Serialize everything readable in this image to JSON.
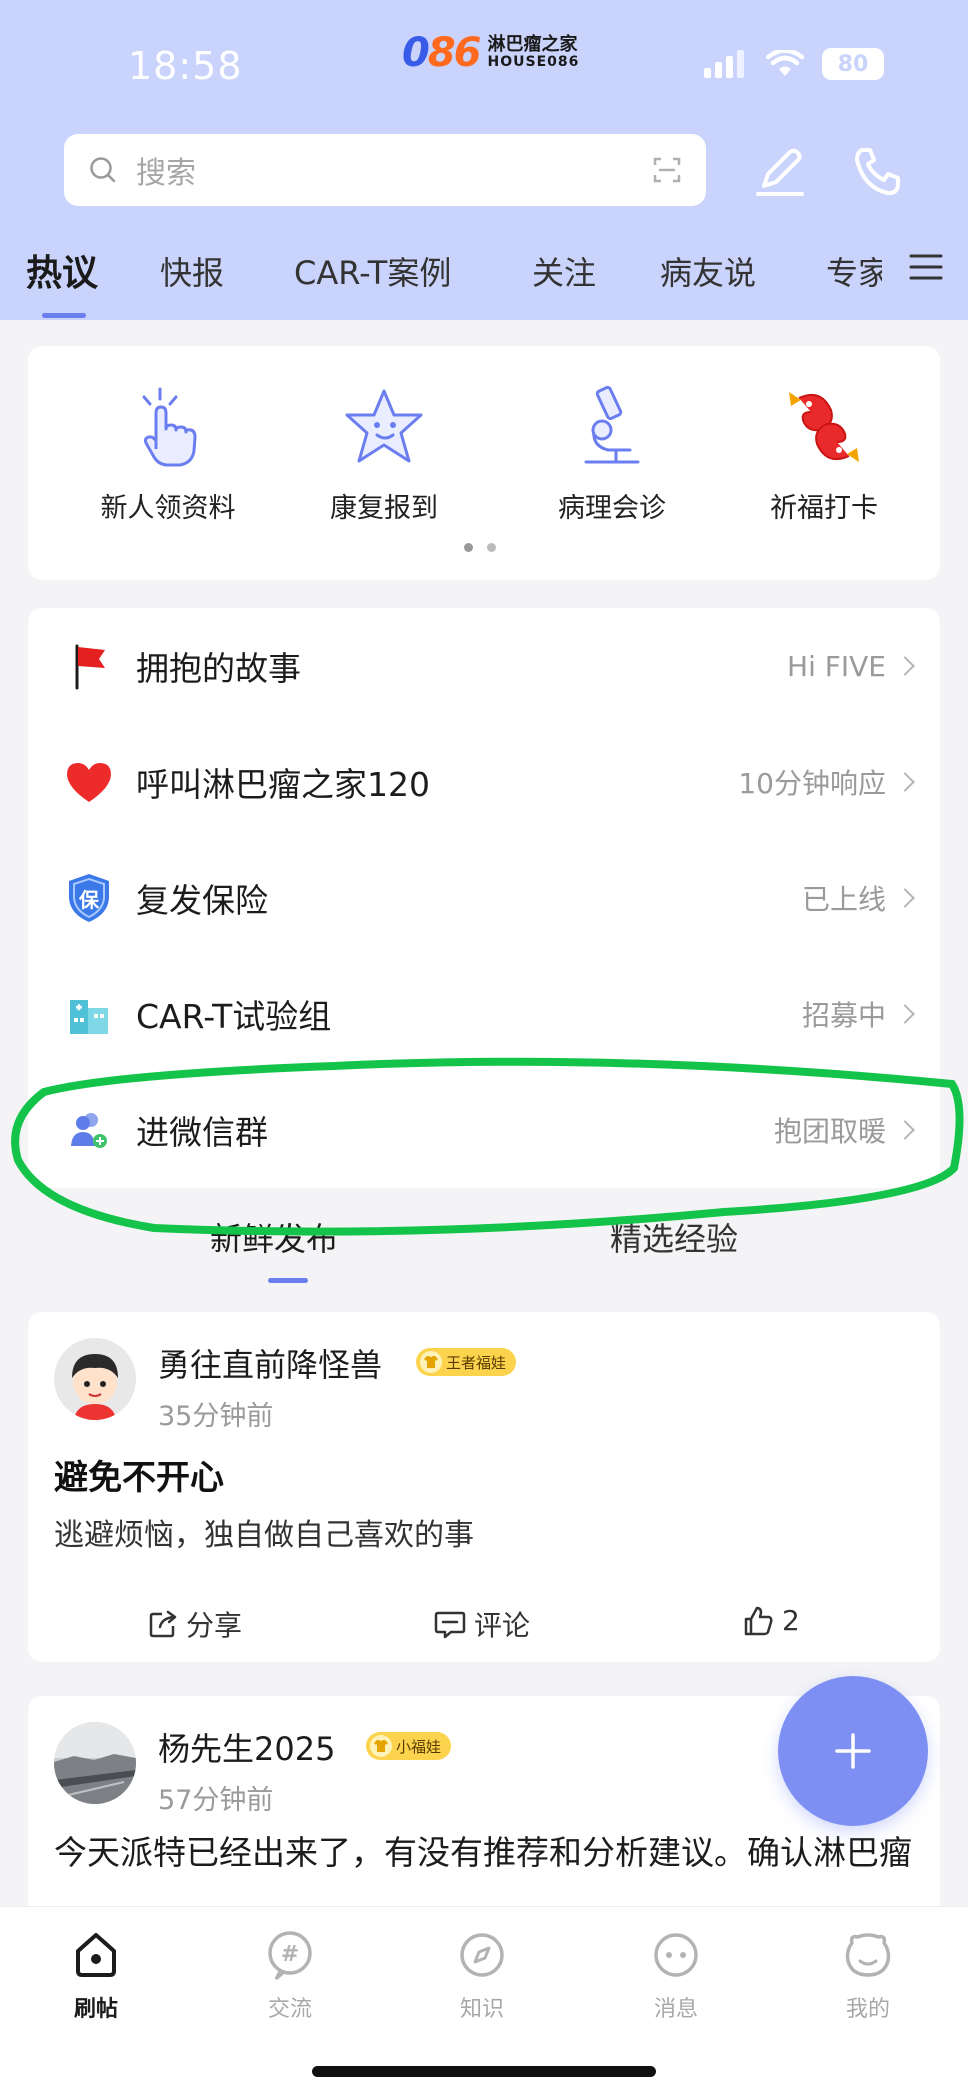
{
  "status_bar": {
    "time": "18:58",
    "battery": "80"
  },
  "logo": {
    "mark_a": "0",
    "mark_b": "86",
    "cn": "淋巴瘤之家",
    "en": "HOUSE086"
  },
  "search": {
    "placeholder": "搜索"
  },
  "tabs": [
    "热议",
    "快报",
    "CAR-T案例",
    "关注",
    "病友说",
    "专家"
  ],
  "quick": [
    {
      "label": "新人领资料",
      "icon": "tap-hand-icon"
    },
    {
      "label": "康复报到",
      "icon": "star-face-icon"
    },
    {
      "label": "病理会诊",
      "icon": "microscope-icon"
    },
    {
      "label": "祈福打卡",
      "icon": "koi-fish-icon"
    }
  ],
  "menu": [
    {
      "label": "拥抱的故事",
      "right": "Hi FIVE",
      "icon": "red-flag-icon"
    },
    {
      "label": "呼叫淋巴瘤之家120",
      "right": "10分钟响应",
      "icon": "heart-icon"
    },
    {
      "label": "复发保险",
      "right": "已上线",
      "icon": "shield-icon",
      "icon_text": "保"
    },
    {
      "label": "CAR-T试验组",
      "right": "招募中",
      "icon": "hospital-icon"
    },
    {
      "label": "进微信群",
      "right": "抱团取暖",
      "icon": "group-add-icon"
    }
  ],
  "feed_tabs": [
    "新鲜发布",
    "精选经验"
  ],
  "posts": [
    {
      "user": "勇往直前降怪兽",
      "badge": "王者福娃",
      "time": "35分钟前",
      "title": "避免不开心",
      "body": "逃避烦恼，独自做自己喜欢的事",
      "share": "分享",
      "comment": "评论",
      "likes": "2"
    },
    {
      "user": "杨先生2025",
      "badge": "小福娃",
      "time": "57分钟前",
      "body": "今天派特已经出来了，有没有推荐和分析建议。确认淋巴瘤"
    }
  ],
  "nav": [
    {
      "label": "刷帖",
      "icon": "home-icon"
    },
    {
      "label": "交流",
      "icon": "hashtag-icon"
    },
    {
      "label": "知识",
      "icon": "compass-icon"
    },
    {
      "label": "消息",
      "icon": "message-face-icon"
    },
    {
      "label": "我的",
      "icon": "profile-face-icon"
    }
  ],
  "colors": {
    "header_bg": "#c9d3fb",
    "accent": "#6b7ef0",
    "fab": "#7e8ff3",
    "highlight": "#14c44a"
  }
}
